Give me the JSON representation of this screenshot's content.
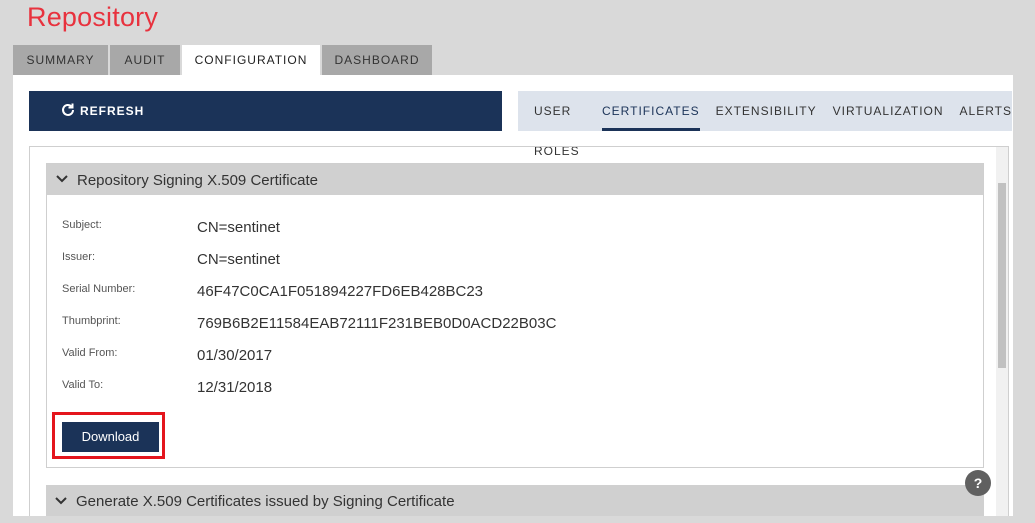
{
  "app": {
    "title": "Repository"
  },
  "main_tabs": [
    {
      "label": "SUMMARY"
    },
    {
      "label": "AUDIT"
    },
    {
      "label": "CONFIGURATION"
    },
    {
      "label": "DASHBOARD"
    }
  ],
  "main_tabs_active": "CONFIGURATION",
  "toolbar": {
    "refresh_label": "REFRESH",
    "refresh_icon": "refresh-icon"
  },
  "sub_tabs": [
    {
      "label": "USER ROLES"
    },
    {
      "label": "CERTIFICATES"
    },
    {
      "label": "EXTENSIBILITY"
    },
    {
      "label": "VIRTUALIZATION"
    },
    {
      "label": "ALERTS"
    }
  ],
  "sub_tabs_active": "CERTIFICATES",
  "signing_cert": {
    "title": "Repository Signing X.509 Certificate",
    "fields": [
      {
        "label": "Subject:",
        "value": "CN=sentinet"
      },
      {
        "label": "Issuer:",
        "value": "CN=sentinet"
      },
      {
        "label": "Serial Number:",
        "value": "46F47C0CA1F051894227FD6EB428BC23"
      },
      {
        "label": "Thumbprint:",
        "value": "769B6B2E11584EAB72111F231BEB0D0ACD22B03C"
      },
      {
        "label": "Valid From:",
        "value": "01/30/2017"
      },
      {
        "label": "Valid To:",
        "value": "12/31/2018"
      }
    ],
    "download_label": "Download"
  },
  "generated_certs": {
    "title": "Generate X.509 Certificates issued by Signing Certificate"
  },
  "help": {
    "label": "?"
  },
  "colors": {
    "brand_red": "#e8323e",
    "navy": "#1b3358",
    "highlight": "#e4151d"
  }
}
